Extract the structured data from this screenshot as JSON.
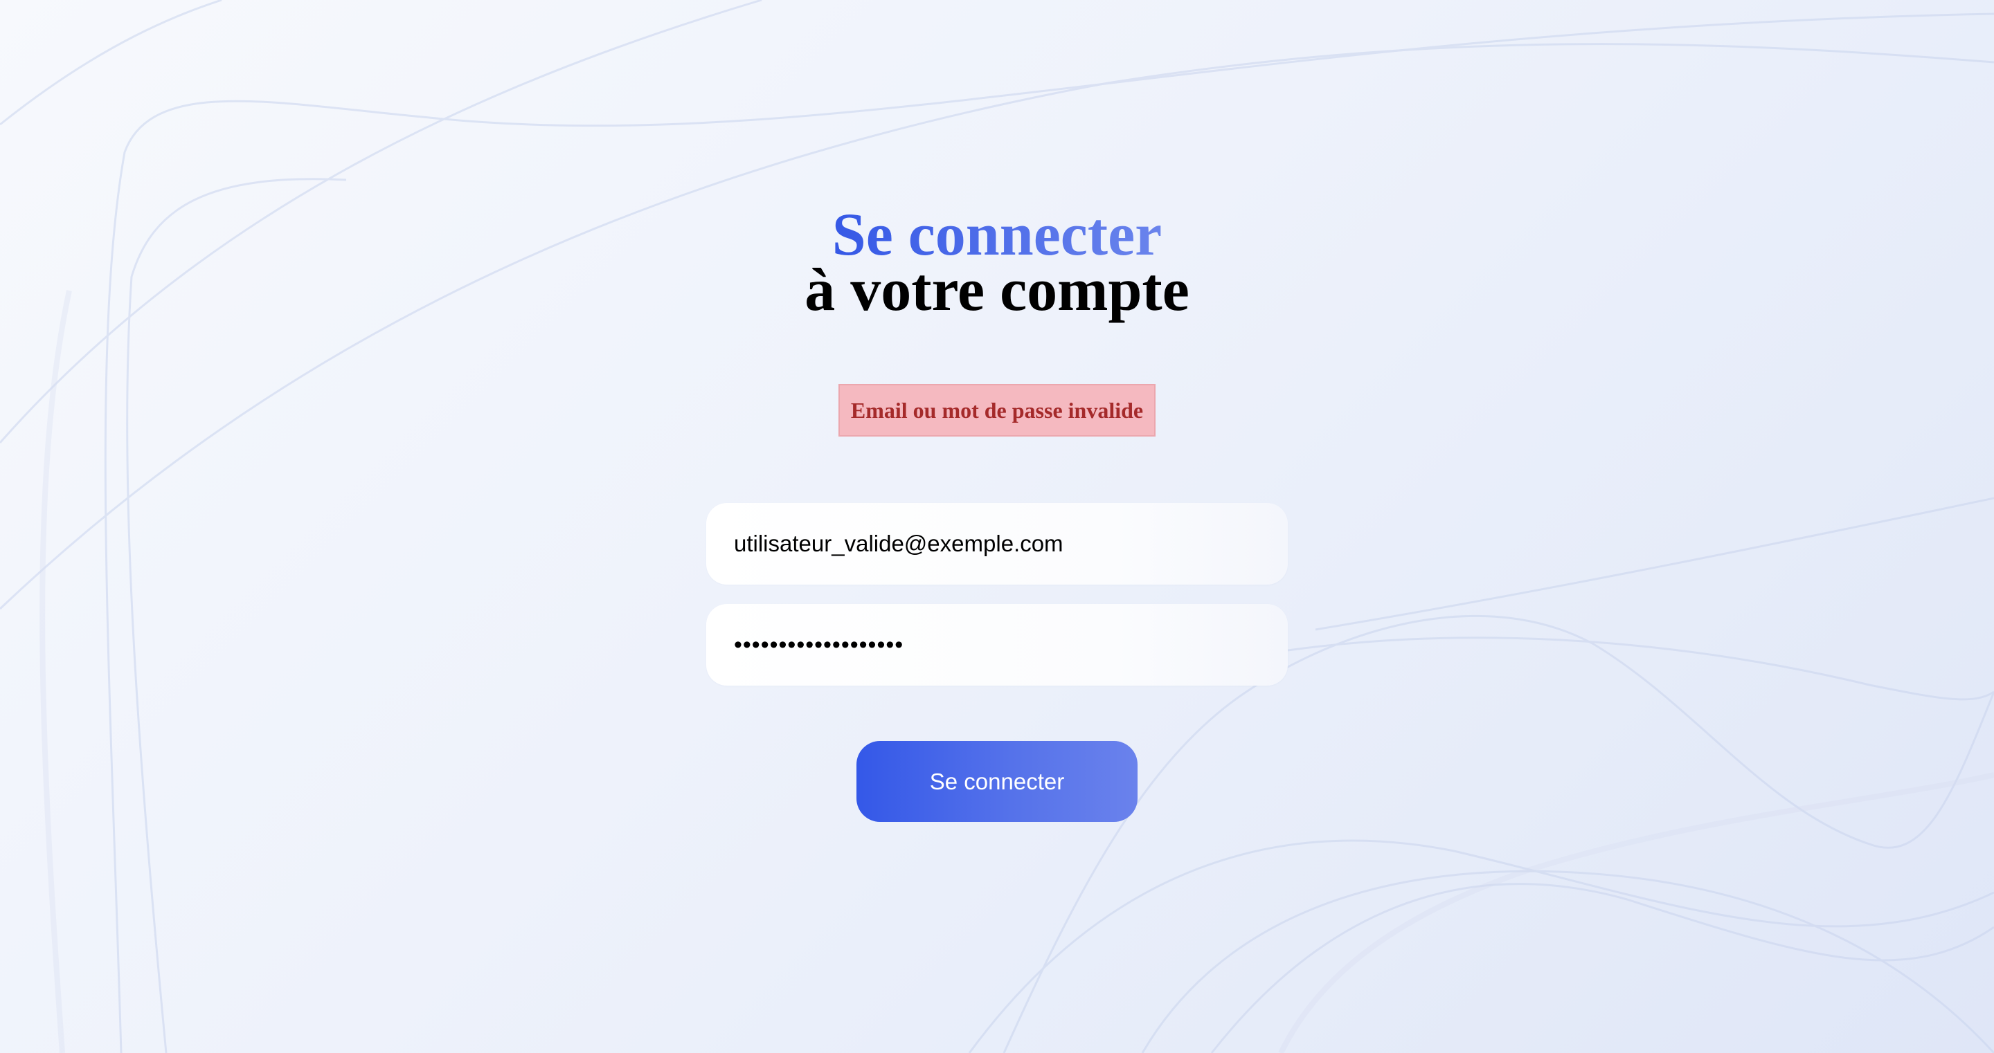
{
  "login": {
    "title_line1": "Se connecter",
    "title_line2": "à votre compte",
    "error_message": "Email ou mot de passe invalide",
    "email": {
      "value": "utilisateur_valide@exemple.com"
    },
    "password": {
      "value": "•••••••••••••••••••"
    },
    "submit_label": "Se connecter"
  },
  "colors": {
    "accent": "#3558e6",
    "error_background": "#f5b9c0",
    "error_text": "#a52a2a"
  }
}
